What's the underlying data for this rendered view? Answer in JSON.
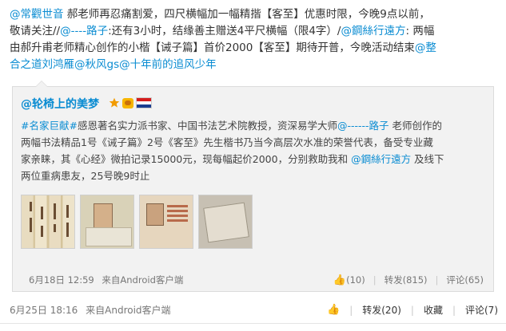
{
  "post": {
    "text_parts": [
      "@常觀世音 郝老师再忍痛割爱，四尺横幅加一幅精揩【客至】优惠时限，今晚9点以前，",
      "敬请关注//@----路子:还有3小时，结缘善主赠送4平尺横幅（限4字）/@鋼絲行遠方: 两幅",
      "由郝升甫老师精心创作的小楷【诫子篇】首价2000【客至】期待开普，今晚活动结束@整",
      "合之道刘鸿雁@秋风gs@十年前的追风少年"
    ],
    "timestamp": "6月25日 18:16",
    "source": "来自Android客户端",
    "actions": {
      "likes": "",
      "forward": "转发(20)",
      "favorite": "收藏",
      "comment": "评论(7)"
    }
  },
  "forward": {
    "author": "@轮椅上的美梦",
    "text_lines": [
      "#名家巨献#感恩著名实力派书家、中国书法艺术院教授，资深易学大师@------路子 老师创作的",
      "两幅书法精品1号《诫子篇》2号《客至》先生楷书乃当今高层次水准的荣誉代表，备受专业藏",
      "家亲睐，其《心经》微拍记录15000元，现每幅起价2000，分别救助我和 @鋼絲行遠方 及线下",
      "两位重病患友，25号晚9时止"
    ],
    "timestamp": "6月18日 12:59",
    "source": "来自Android客户端",
    "actions": {
      "like": "(10)",
      "forward": "转发(815)",
      "comment": "评论(65)"
    }
  },
  "icons": {
    "star": "star-icon",
    "vip": "vip-badge-icon",
    "flag": "netherlands-flag-icon",
    "thumbs": "thumbs-up-icon"
  },
  "colors": {
    "link": "#0a8cd2",
    "forward_bg": "#f2f2f2"
  }
}
